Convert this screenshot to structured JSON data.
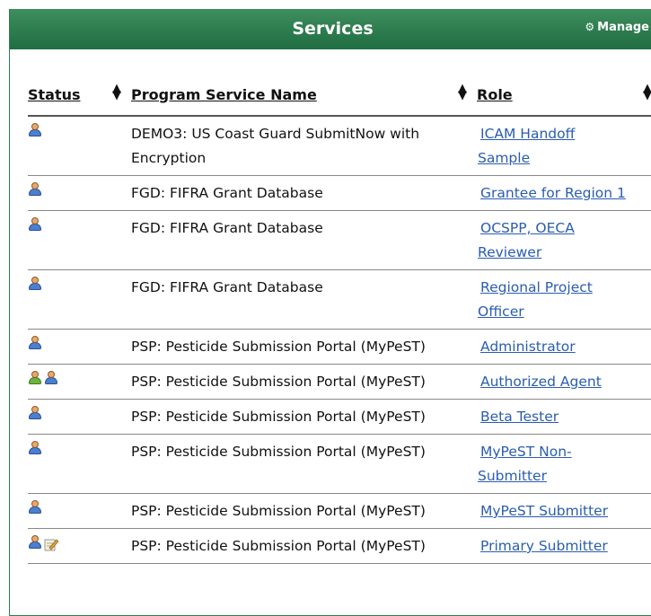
{
  "header": {
    "title": "Services",
    "manage_label": "Manage"
  },
  "columns": {
    "status": "Status",
    "name": "Program Service Name",
    "role": "Role"
  },
  "rows": [
    {
      "name_line1": "DEMO3: US Coast Guard SubmitNow with",
      "name_line2": "Encryption",
      "role_line1": "ICAM Handoff",
      "role_line2": "Sample",
      "icons": [
        "user-icon"
      ]
    },
    {
      "name_line1": "FGD: FIFRA Grant Database",
      "role_line1": "Grantee for Region 1",
      "icons": [
        "user-icon"
      ]
    },
    {
      "name_line1": "FGD: FIFRA Grant Database",
      "role_line1": "OCSPP, OECA",
      "role_line2": "Reviewer",
      "icons": [
        "user-icon"
      ]
    },
    {
      "name_line1": "FGD: FIFRA Grant Database",
      "role_line1": "Regional Project",
      "role_line2": "Officer",
      "icons": [
        "user-icon"
      ]
    },
    {
      "name_line1": "PSP: Pesticide Submission Portal (MyPeST)",
      "role_line1": "Administrator",
      "icons": [
        "user-icon"
      ]
    },
    {
      "name_line1": "PSP: Pesticide Submission Portal (MyPeST)",
      "role_line1": "Authorized Agent",
      "icons": [
        "green-user-icon",
        "user-icon"
      ]
    },
    {
      "name_line1": "PSP: Pesticide Submission Portal (MyPeST)",
      "role_line1": "Beta Tester",
      "icons": [
        "user-icon"
      ]
    },
    {
      "name_line1": "PSP: Pesticide Submission Portal (MyPeST)",
      "role_line1": "MyPeST Non-",
      "role_line2": "Submitter",
      "icons": [
        "user-icon"
      ]
    },
    {
      "name_line1": "PSP: Pesticide Submission Portal (MyPeST)",
      "role_line1": "MyPeST Submitter",
      "icons": [
        "user-icon"
      ]
    },
    {
      "name_line1": "PSP: Pesticide Submission Portal (MyPeST)",
      "role_line1": "Primary Submitter",
      "icons": [
        "user-icon",
        "edit-icon"
      ]
    }
  ],
  "colors": {
    "header_green": "#2a7a4c",
    "link_blue": "#2a5db0"
  }
}
